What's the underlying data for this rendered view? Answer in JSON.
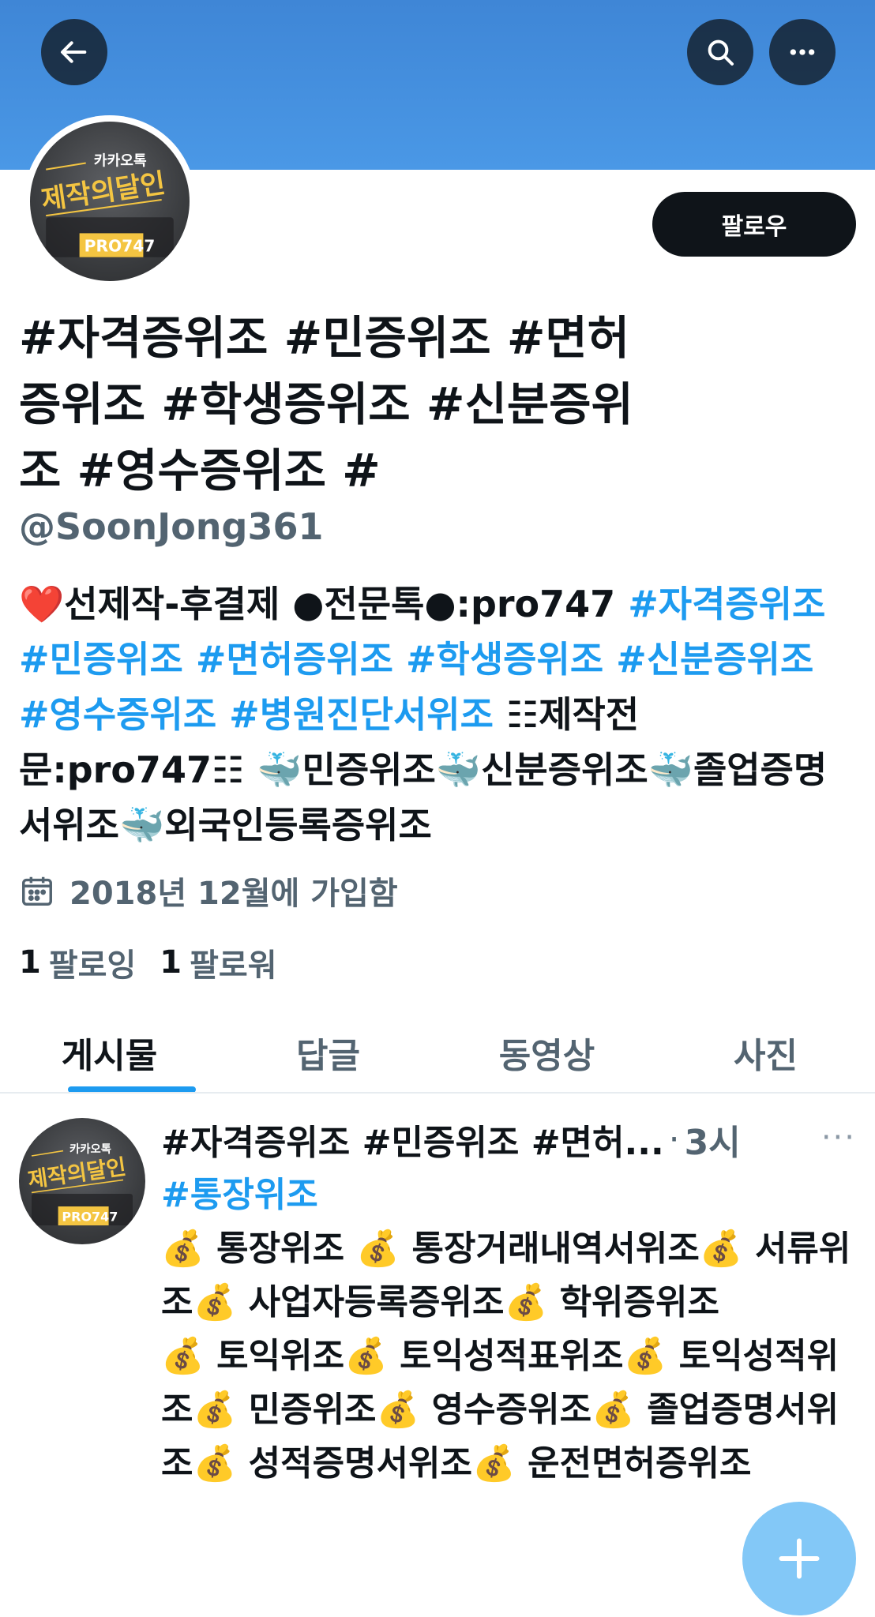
{
  "header": {
    "back_icon": "arrow-left-icon",
    "search_icon": "search-icon",
    "more_icon": "more-horizontal-icon"
  },
  "avatar": {
    "logo_small": "카카오톡",
    "logo_main": "제작의달인",
    "logo_code": "PRO747"
  },
  "follow_button": {
    "label": "팔로우"
  },
  "profile": {
    "display_name": "#자격증위조 #민증위조 #면허증위조 #학생증위조 #신분증위조 #영수증위조 #",
    "handle": "@SoonJong361",
    "bio": {
      "heart": "❤️",
      "intro": "선제작-후결제 ●전문톡●:pro747 ",
      "tags": "#자격증위조 #민증위조 #면허증위조 #학생증위조 #신분증위조 #영수증위조 #병원진단서위조",
      "rest": " ☷제작전문:pro747☷ ",
      "whale": "🐳",
      "items": [
        "민증위조",
        "신분증위조",
        "졸업증명서위조",
        "외국인등록증위조"
      ]
    },
    "joined": "2018년 12월에 가입함",
    "following_count": "1",
    "following_label": "팔로잉",
    "followers_count": "1",
    "followers_label": "팔로워"
  },
  "tabs": [
    "게시물",
    "답글",
    "동영상",
    "사진"
  ],
  "tweet": {
    "name": "#자격증위조 #민증위조 #면허...",
    "separator": "·",
    "time": "3시",
    "more": "···",
    "tag_line": "#통장위조",
    "money_emoji": "💰",
    "line1": [
      "통장위조 ",
      "통장거래내역서위조",
      "서류위조",
      "사업자등록증위조",
      "학위증위조"
    ],
    "line2": [
      "토익위조",
      "토익성적표위조",
      "토익성적위조",
      "민증위조",
      "영수증위조",
      "졸업증명서위조",
      "성적증명서위조",
      "운전면허증위조"
    ]
  },
  "fab": {
    "icon": "plus-icon"
  }
}
